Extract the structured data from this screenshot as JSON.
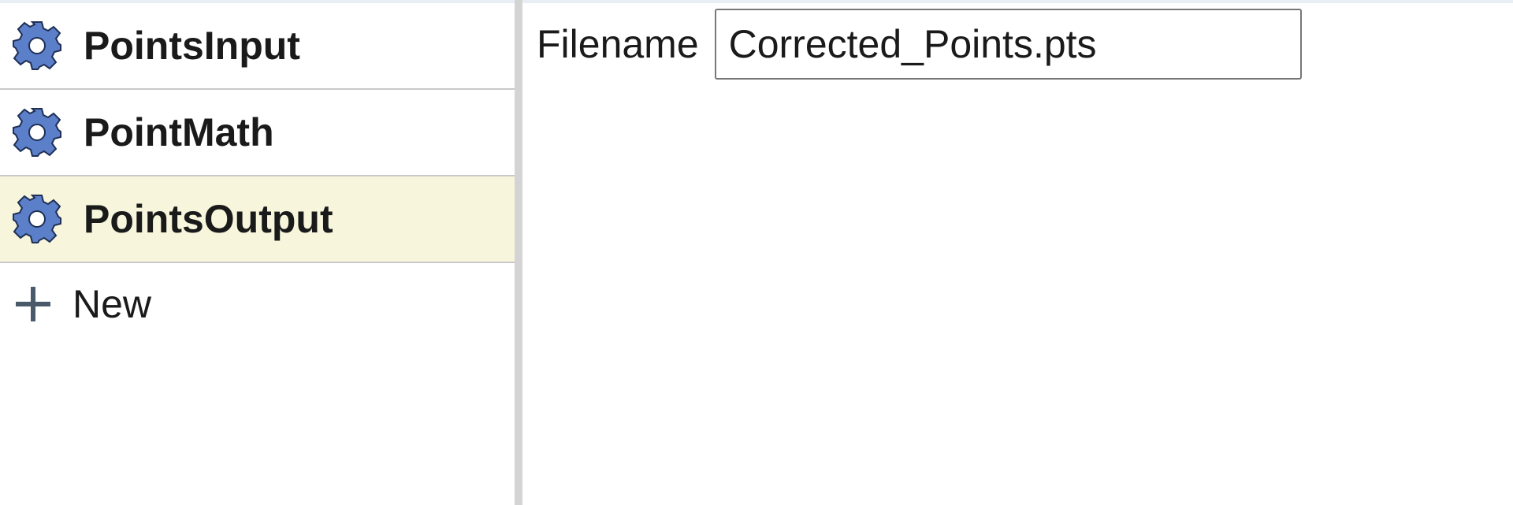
{
  "sidebar": {
    "items": [
      {
        "label": "PointsInput",
        "icon": "gear-icon",
        "selected": false
      },
      {
        "label": "PointMath",
        "icon": "gear-icon",
        "selected": false
      },
      {
        "label": "PointsOutput",
        "icon": "gear-icon",
        "selected": true
      }
    ],
    "new_item": {
      "label": "New",
      "icon": "plus-icon"
    }
  },
  "main": {
    "filename_label": "Filename",
    "filename_value": "Corrected_Points.pts"
  },
  "colors": {
    "selected_bg": "#f7f6dc",
    "gear_fill": "#5b7fc9",
    "plus_color": "#4a5a6a",
    "splitter": "#d4d4d4"
  }
}
